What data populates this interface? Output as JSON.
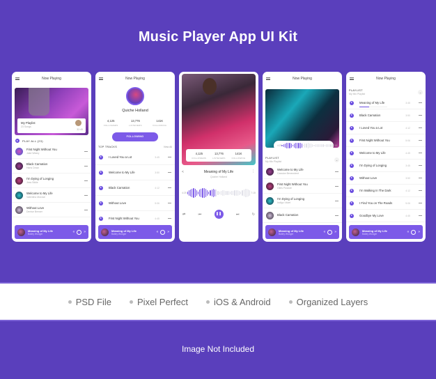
{
  "page": {
    "title": "Music Player App UI Kit",
    "features": [
      "PSD File",
      "Pixel Perfect",
      "iOS & Android",
      "Organized Layers"
    ],
    "footer_note": "Image Not Included",
    "colors": {
      "background": "#5a3fbc",
      "accent": "#7c5ae8",
      "play": "#6a4de0",
      "band": "#ffffff"
    }
  },
  "mini_player": {
    "title": "Meaning of My Life",
    "artist": "Bailey Wonger"
  },
  "screen1": {
    "header": "Now Playing",
    "card_title": "My Playlist",
    "card_sub": "23 Songs",
    "card_time": "32:45",
    "play_all": "PLAY ALL (23)",
    "tracks": [
      {
        "title": "First Night Without You",
        "artist": "Jake Weary"
      },
      {
        "title": "Black Carnation",
        "artist": "Hans Down"
      },
      {
        "title": "I'm Dying of Longing",
        "artist": "Jess Stikle"
      },
      {
        "title": "Welcome to My Life",
        "artist": "Valentino Morose"
      },
      {
        "title": "Without Love",
        "artist": "Denise Brewer"
      }
    ]
  },
  "screen2": {
    "header": "Now Playing",
    "artist": "Quiche Holland",
    "stats": [
      {
        "value": "4,125",
        "label": "FOLLOWERS"
      },
      {
        "value": "13,776",
        "label": "LISTENERS"
      },
      {
        "value": "141K",
        "label": "FOLLOWING"
      }
    ],
    "follow_button": "FOLLOWING",
    "section": "TOP TRACKS",
    "view_all": "View All",
    "tracks": [
      {
        "title": "I Loved You a Lot",
        "duration": "3:45"
      },
      {
        "title": "Welcome to My Life",
        "duration": "3:50"
      },
      {
        "title": "Black Carnation",
        "duration": "4:12"
      },
      {
        "title": "Without Love",
        "duration": "5:06"
      },
      {
        "title": "First Night Without You",
        "duration": "4:45"
      }
    ]
  },
  "screen3": {
    "stats": [
      {
        "value": "4,125",
        "label": "FOLLOWERS"
      },
      {
        "value": "13,776",
        "label": "LISTENERS"
      },
      {
        "value": "141K",
        "label": "FOLLOWING"
      }
    ],
    "song": "Meaning of My Life",
    "artist": "Quiche Holland",
    "elapsed": "4:25",
    "total": "7:15",
    "progress": 0.45
  },
  "screen4": {
    "header": "Now Playing",
    "elapsed": "4:25",
    "total": "7:15",
    "progress": 0.4,
    "section": "PLAYLIST",
    "playlist_name": "My Mix Playlist",
    "tracks": [
      {
        "title": "Welcome to My Life",
        "artist": "Cassian Benevolent"
      },
      {
        "title": "First Night Without You",
        "artist": "Giles Posture"
      },
      {
        "title": "I'm Dying of Longing",
        "artist": "Indigo Violet"
      },
      {
        "title": "Black Carnation",
        "artist": ""
      }
    ]
  },
  "screen5": {
    "header": "Now Playing",
    "section": "PLAYLIST",
    "playlist_name": "My Mix Playlist",
    "current_progress": 0.35,
    "tracks": [
      {
        "title": "Meaning of My Life",
        "duration": "3:45"
      },
      {
        "title": "Black Carnation",
        "duration": "3:50"
      },
      {
        "title": "I Loved You a Lot",
        "duration": "4:12"
      },
      {
        "title": "First Night Without You",
        "duration": "5:06"
      },
      {
        "title": "Welcome to My Life",
        "duration": "4:45"
      },
      {
        "title": "I'm Dying of Longing",
        "duration": "3:45"
      },
      {
        "title": "Without Love",
        "duration": "3:50"
      },
      {
        "title": "I'm Walking In The Dark",
        "duration": "4:12"
      },
      {
        "title": "I Find You on The Roads",
        "duration": "5:06"
      },
      {
        "title": "Goodbye My Love",
        "duration": "4:45"
      }
    ]
  }
}
